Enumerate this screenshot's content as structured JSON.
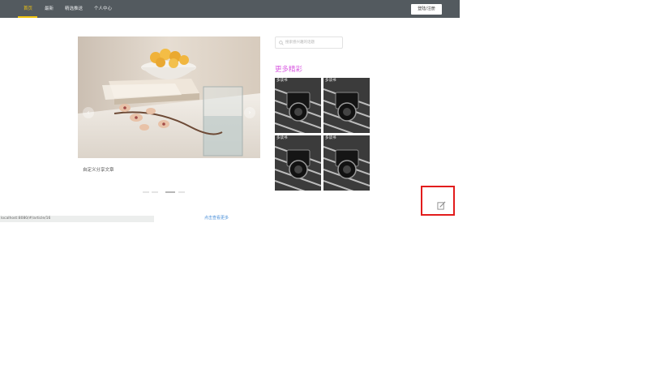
{
  "nav": {
    "items": [
      {
        "label": "首页",
        "active": true
      },
      {
        "label": "最新",
        "active": false
      },
      {
        "label": "精选推送",
        "active": false
      },
      {
        "label": "个人中心",
        "active": false
      }
    ],
    "login_label": "登陆/注册",
    "bar_color": "#535a5f",
    "accent_color": "#f1c40f"
  },
  "carousel": {
    "caption": "自定义分享文章",
    "prev_icon": "chevron-left-icon",
    "next_icon": "chevron-right-icon",
    "slide_count": 4,
    "active_slide": 3
  },
  "sidebar": {
    "search_placeholder": "搜索感兴趣的话题",
    "more_title": "更多精彩",
    "more_title_color": "#d95fe2",
    "thumbnails": [
      {
        "label": "多读书"
      },
      {
        "label": "多读书"
      },
      {
        "label": "多读书"
      },
      {
        "label": "多读书"
      }
    ]
  },
  "view_more": "点击查看更多",
  "edit_button": {
    "icon": "edit-icon",
    "highlight_color": "#e21c1c"
  },
  "statusbar": {
    "url": "localhost:8080/#/article/16"
  }
}
